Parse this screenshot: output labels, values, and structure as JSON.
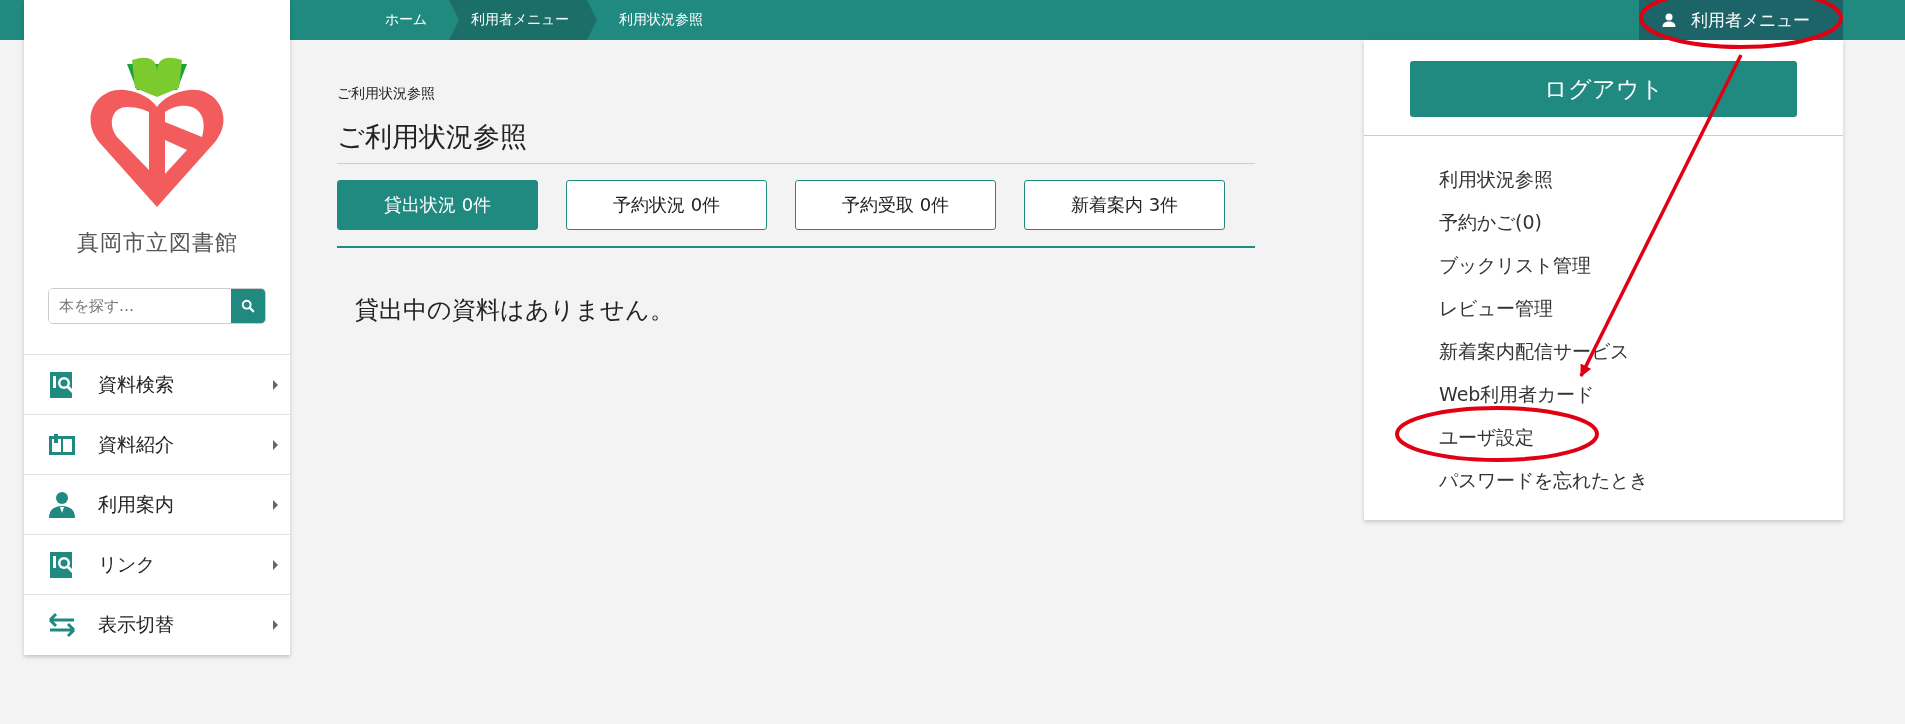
{
  "breadcrumb": [
    {
      "label": "ホーム",
      "selected": false
    },
    {
      "label": "利用者メニュー",
      "selected": true
    },
    {
      "label": "利用状況参照",
      "selected": false
    }
  ],
  "user_menu": {
    "label": "利用者メニュー",
    "expanded": true,
    "logout": "ログアウト",
    "items": [
      "利用状況参照",
      "予約かご(0)",
      "ブックリスト管理",
      "レビュー管理",
      "新着案内配信サービス",
      "Web利用者カード",
      "ユーザ設定",
      "パスワードを忘れたとき"
    ]
  },
  "sidebar": {
    "library_name": "真岡市立図書館",
    "search": {
      "placeholder": "本を探す…"
    },
    "items": [
      {
        "label": "資料検索"
      },
      {
        "label": "資料紹介"
      },
      {
        "label": "利用案内"
      },
      {
        "label": "リンク"
      },
      {
        "label": "表示切替"
      }
    ]
  },
  "page": {
    "breadcrumb_title": "ご利用状況参照",
    "title": "ご利用状況参照",
    "tabs": [
      {
        "label": "貸出状況 0件",
        "selected": true
      },
      {
        "label": "予約状況 0件",
        "selected": false
      },
      {
        "label": "予約受取 0件",
        "selected": false
      },
      {
        "label": "新着案内 3件",
        "selected": false
      }
    ],
    "message": "貸出中の資料はありません。"
  }
}
